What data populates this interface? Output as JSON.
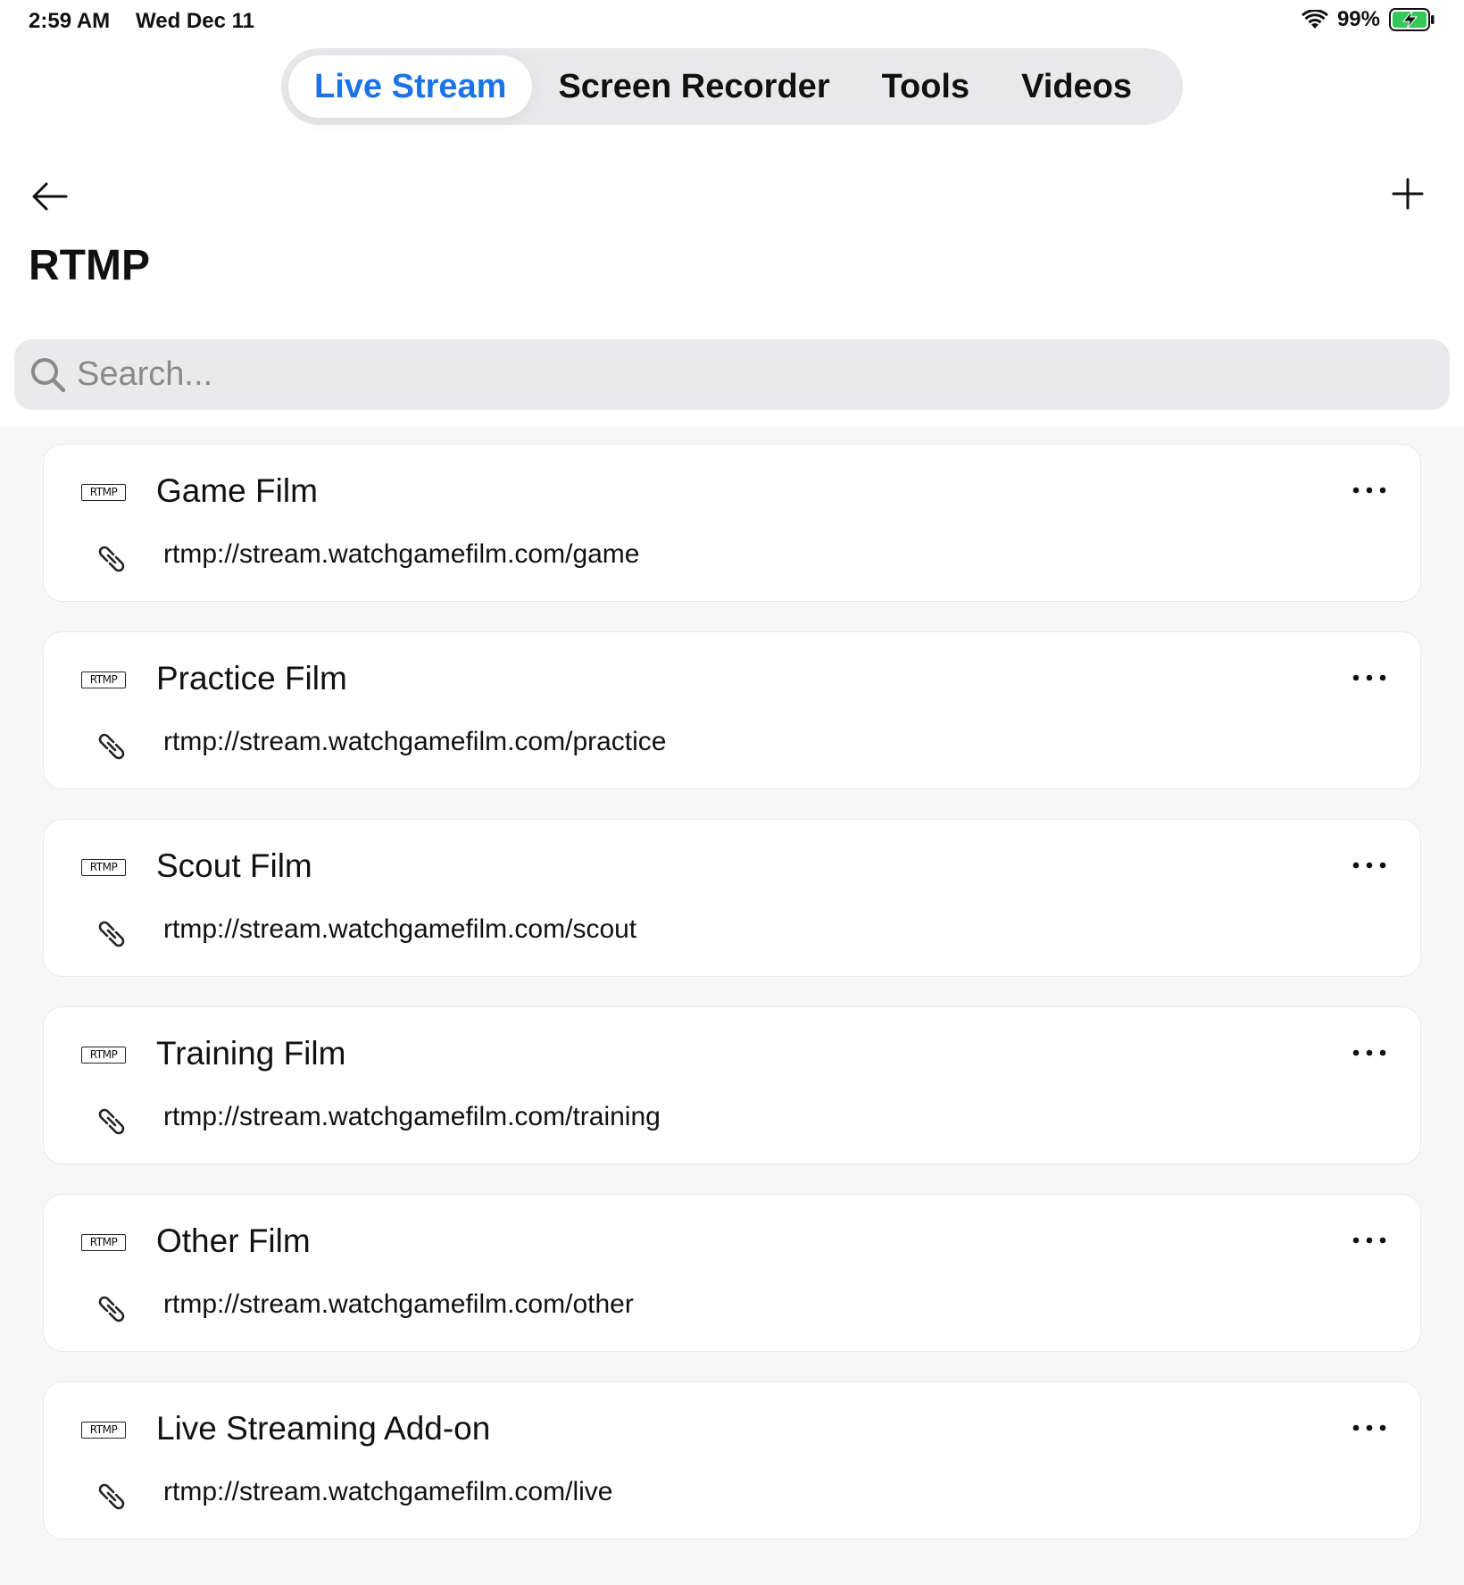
{
  "status_bar": {
    "time": "2:59 AM",
    "date": "Wed Dec 11",
    "battery": "99%"
  },
  "tabs": [
    {
      "label": "Live Stream",
      "active": true
    },
    {
      "label": "Screen Recorder",
      "active": false
    },
    {
      "label": "Tools",
      "active": false
    },
    {
      "label": "Videos",
      "active": false
    }
  ],
  "page": {
    "title": "RTMP"
  },
  "search": {
    "placeholder": "Search..."
  },
  "items": [
    {
      "badge": "RTMP",
      "title": "Game Film",
      "url": "rtmp://stream.watchgamefilm.com/game"
    },
    {
      "badge": "RTMP",
      "title": "Practice Film",
      "url": "rtmp://stream.watchgamefilm.com/practice"
    },
    {
      "badge": "RTMP",
      "title": "Scout Film",
      "url": "rtmp://stream.watchgamefilm.com/scout"
    },
    {
      "badge": "RTMP",
      "title": "Training Film",
      "url": "rtmp://stream.watchgamefilm.com/training"
    },
    {
      "badge": "RTMP",
      "title": "Other Film",
      "url": "rtmp://stream.watchgamefilm.com/other"
    },
    {
      "badge": "RTMP",
      "title": "Live Streaming Add-on",
      "url": "rtmp://stream.watchgamefilm.com/live"
    }
  ],
  "colors": {
    "accent": "#1a73e8",
    "battery_green": "#34c759"
  }
}
